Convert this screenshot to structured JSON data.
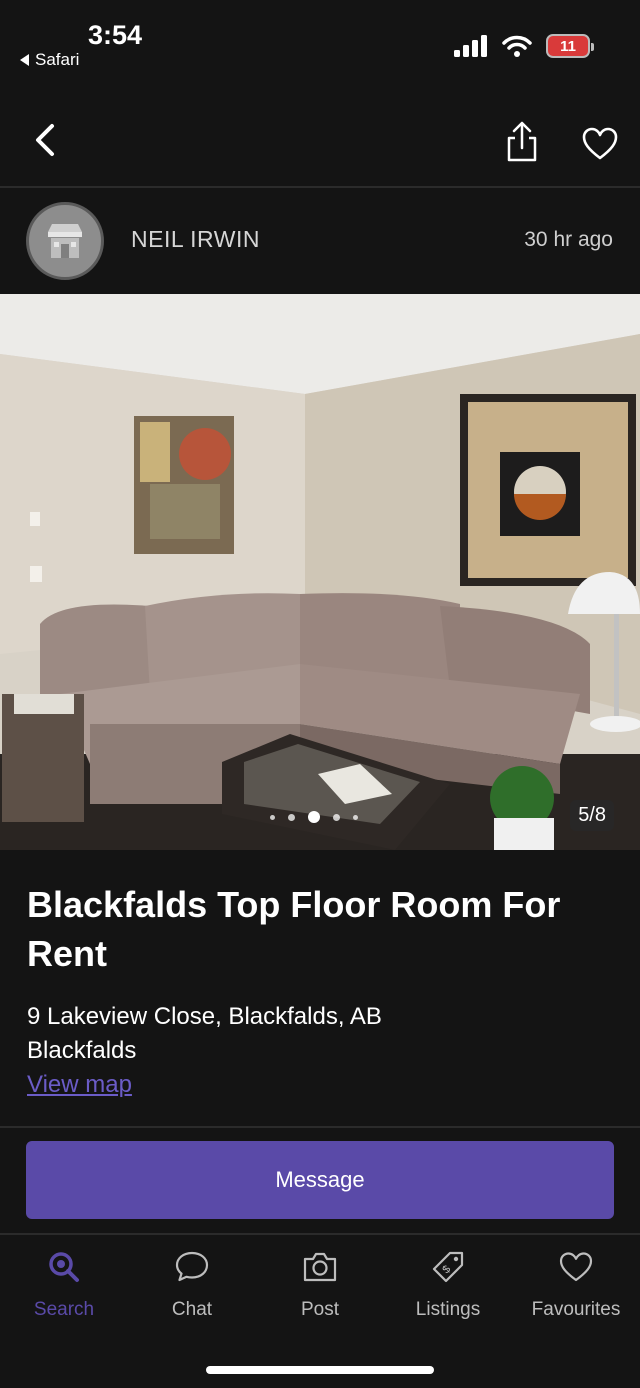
{
  "status_bar": {
    "time": "3:54",
    "back_app": "Safari",
    "battery_level": "11",
    "icons": [
      "signal-icon",
      "wifi-icon",
      "battery-icon"
    ]
  },
  "nav": {
    "icons": [
      "chevron-left-icon",
      "share-icon",
      "heart-icon"
    ]
  },
  "seller": {
    "name": "NEIL IRWIN",
    "posted": "30 hr  ago",
    "avatar_icon": "storefront-icon"
  },
  "gallery": {
    "counter": "5/8",
    "current": 3,
    "total_dots": 5
  },
  "listing": {
    "title": "Blackfalds Top Floor Room For Rent",
    "address": "9 Lakeview Close, Blackfalds, AB",
    "city": "Blackfalds",
    "map_link": "View map"
  },
  "actions": {
    "message_label": "Message"
  },
  "tab_bar": {
    "tabs": [
      {
        "label": "Search",
        "icon": "search-icon",
        "active": true
      },
      {
        "label": "Chat",
        "icon": "chat-bubble-icon",
        "active": false
      },
      {
        "label": "Post",
        "icon": "camera-icon",
        "active": false
      },
      {
        "label": "Listings",
        "icon": "tag-icon",
        "active": false
      },
      {
        "label": "Favourites",
        "icon": "heart-icon",
        "active": false
      }
    ]
  },
  "colors": {
    "background": "#141414",
    "accent": "#5a4aa8",
    "link": "#6b5cc7"
  }
}
